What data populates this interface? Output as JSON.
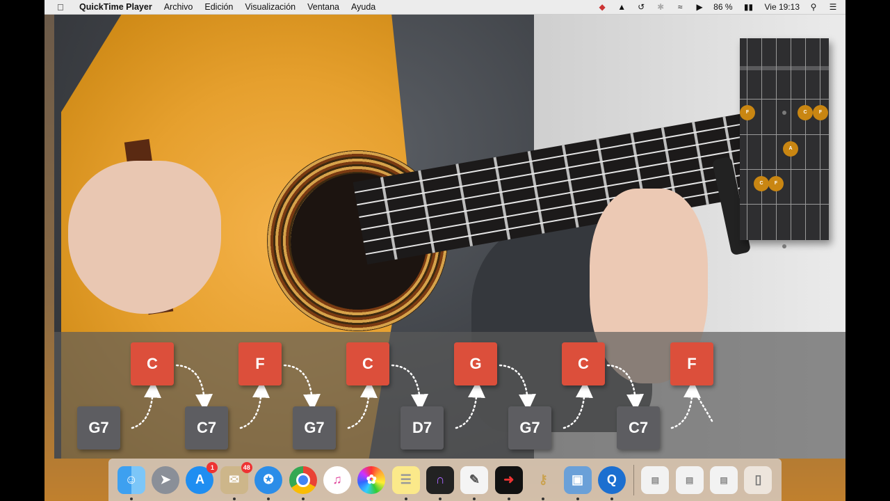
{
  "menubar": {
    "app_name": "QuickTime Player",
    "menus": [
      "Archivo",
      "Edición",
      "Visualización",
      "Ventana",
      "Ayuda"
    ],
    "status": {
      "battery_percent": "86 %",
      "clock": "Vie 19:13"
    }
  },
  "chord_diagram": {
    "notes": [
      "F",
      "C",
      "F",
      "A",
      "C",
      "F"
    ]
  },
  "progression": {
    "upper": [
      "C",
      "F",
      "C",
      "G",
      "C",
      "F"
    ],
    "lower": [
      "G7",
      "C7",
      "G7",
      "D7",
      "G7",
      "C7"
    ],
    "colors": {
      "upper": "#dc4f3b",
      "lower": "#5d5d61"
    }
  },
  "dock": {
    "items": [
      {
        "name": "Finder",
        "icon": "finder-icon",
        "running": true
      },
      {
        "name": "Launchpad",
        "icon": "rocket-icon",
        "running": false
      },
      {
        "name": "App Store",
        "icon": "app-store-icon",
        "badge": "1",
        "running": false
      },
      {
        "name": "Mail",
        "icon": "mail-icon",
        "badge": "48",
        "running": true
      },
      {
        "name": "Safari",
        "icon": "compass-icon",
        "running": true
      },
      {
        "name": "Chrome",
        "icon": "chrome-icon",
        "running": true
      },
      {
        "name": "iTunes",
        "icon": "music-icon",
        "running": false
      },
      {
        "name": "Photos",
        "icon": "photos-icon",
        "running": false
      },
      {
        "name": "Notes",
        "icon": "notes-icon",
        "running": true
      },
      {
        "name": "Pro Tools",
        "icon": "protools-icon",
        "running": true
      },
      {
        "name": "TextEdit",
        "icon": "textedit-icon",
        "running": true
      },
      {
        "name": "Sibelius",
        "icon": "sibelius-icon",
        "running": true
      },
      {
        "name": "Keychain",
        "icon": "keys-icon",
        "running": true
      },
      {
        "name": "Preview",
        "icon": "preview-icon",
        "running": true
      },
      {
        "name": "QuickTime Player",
        "icon": "quicktime-icon",
        "running": true
      }
    ],
    "stack_items": [
      {
        "icon": "document-stack-icon"
      },
      {
        "icon": "document-stack-icon"
      },
      {
        "icon": "document-stack-icon"
      },
      {
        "icon": "trash-icon"
      }
    ]
  }
}
